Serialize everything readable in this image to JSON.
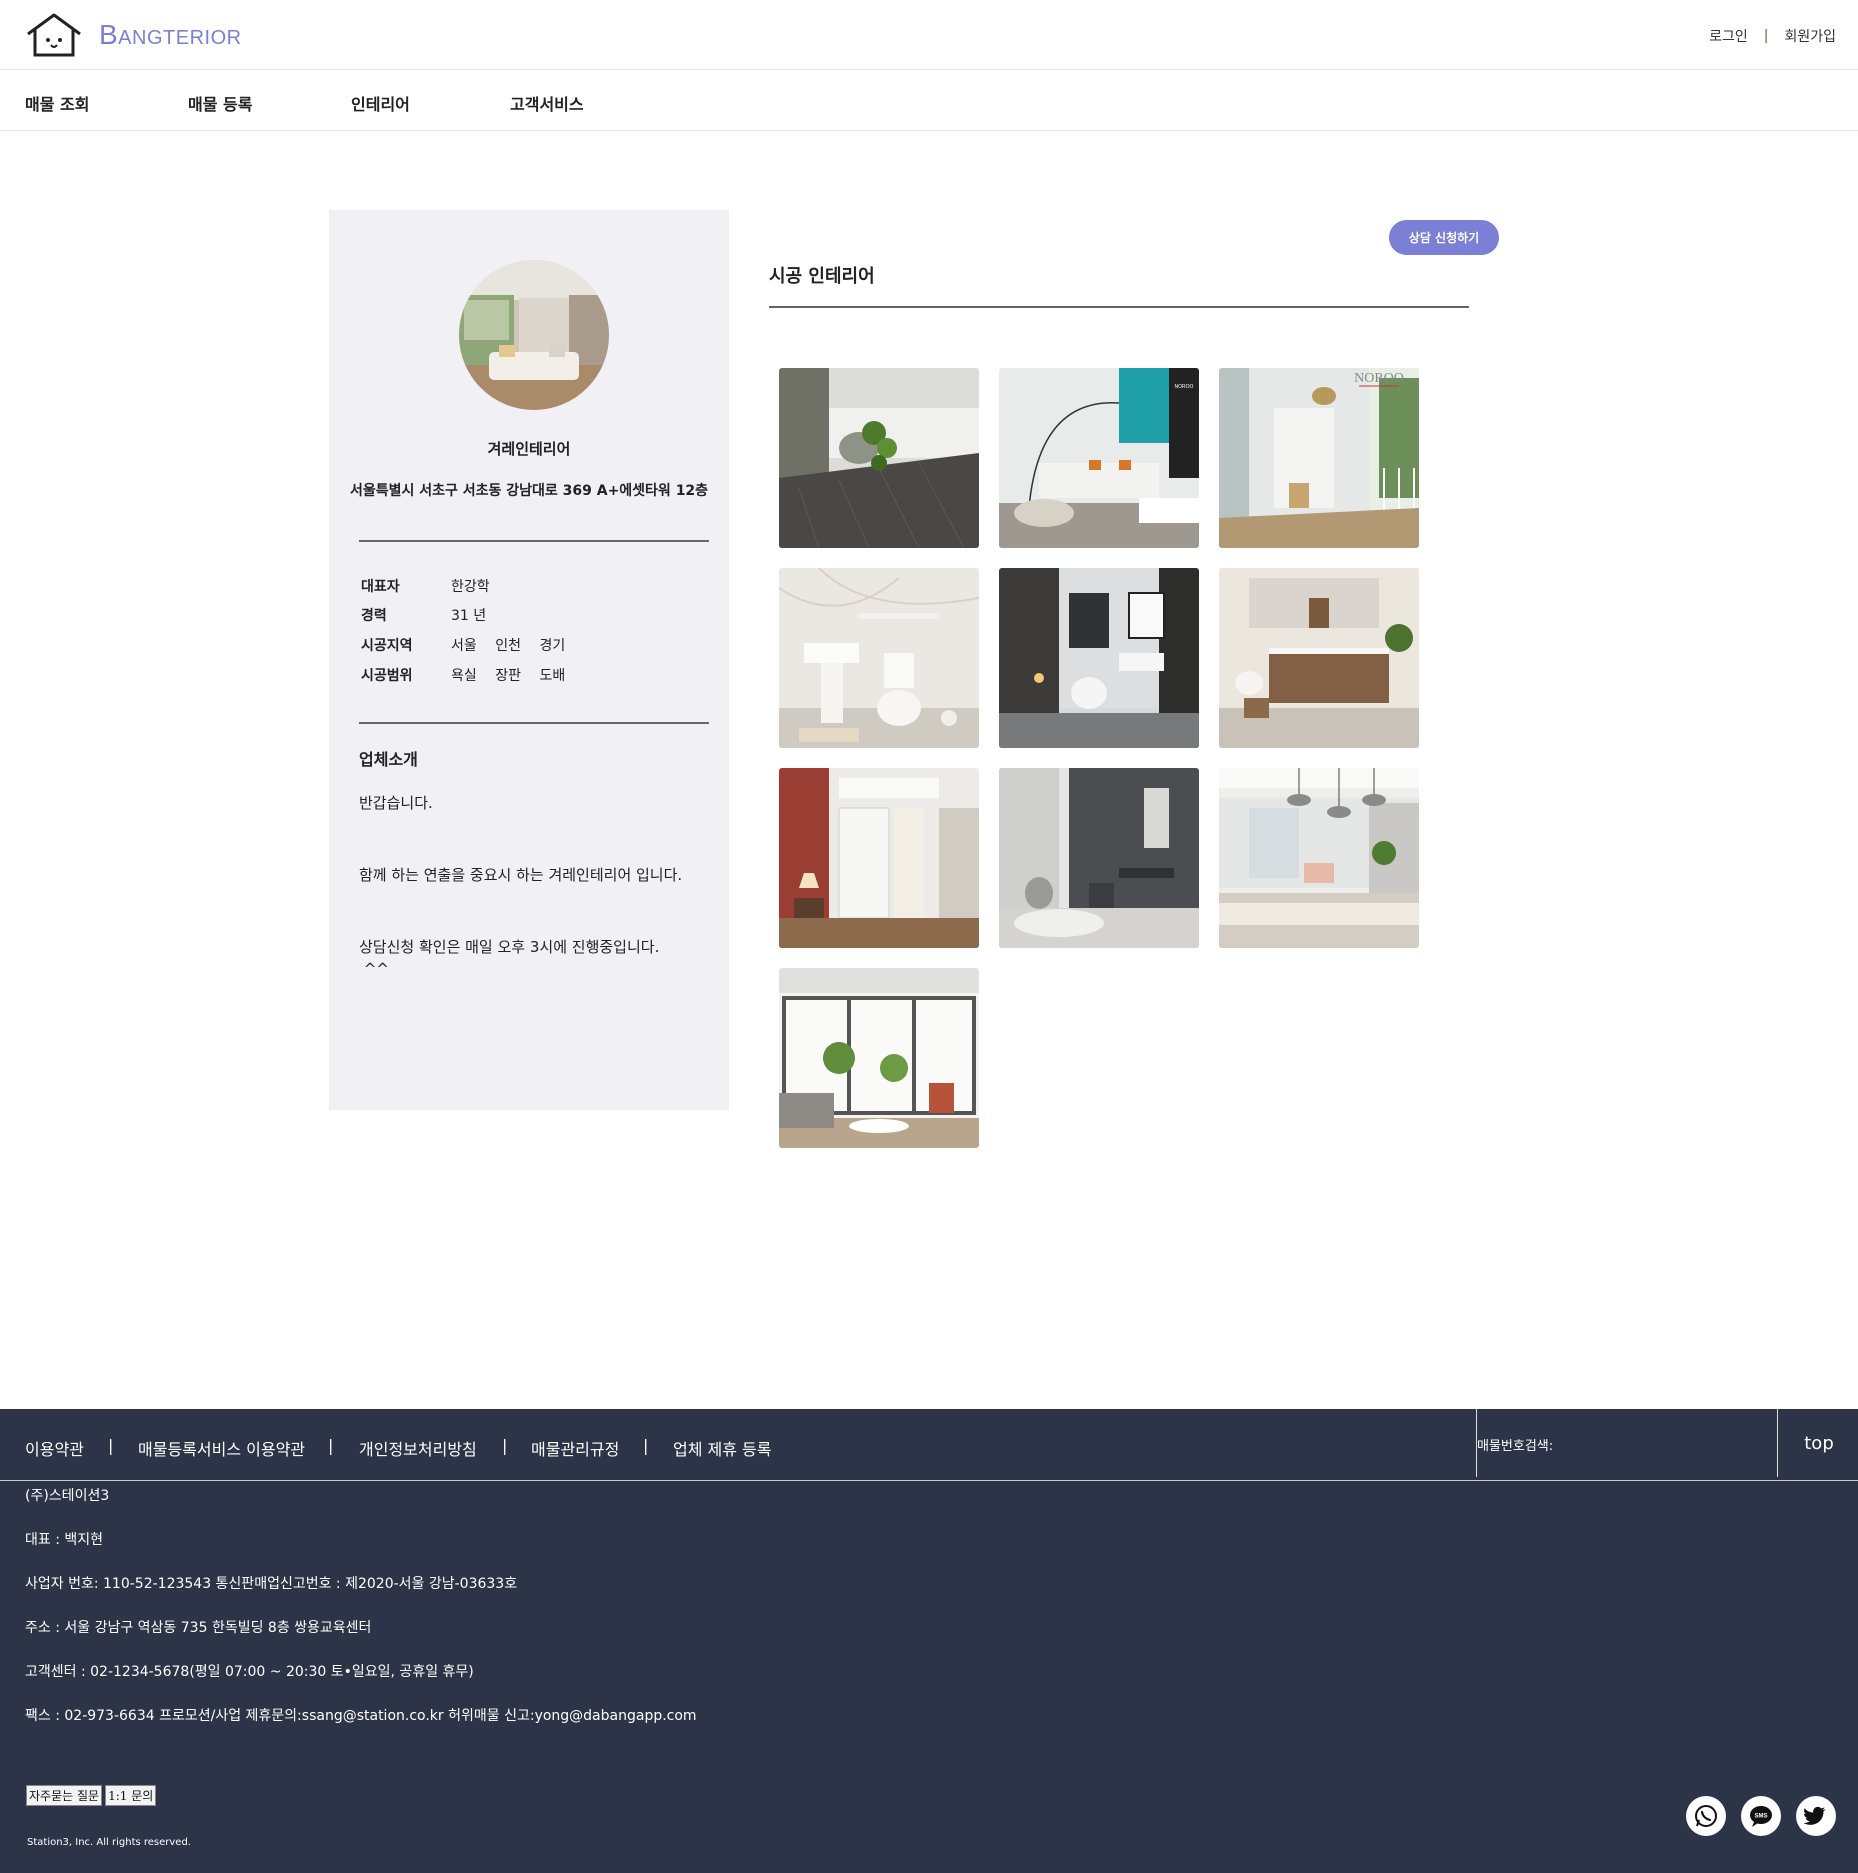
{
  "header": {
    "logo_text": "Bangterior",
    "login": "로그인",
    "separator": "|",
    "signup": "회원가입"
  },
  "nav": {
    "items": [
      "매물 조회",
      "매물 등록",
      "인테리어",
      "고객서비스"
    ]
  },
  "company": {
    "name": "겨레인테리어",
    "address": "서울특별시 서초구 서초동 강남대로 369 A+에셋타워 12층",
    "rows": [
      {
        "key": "대표자",
        "values": [
          "한강학"
        ]
      },
      {
        "key": "경력",
        "values": [
          "31 년"
        ]
      },
      {
        "key": "시공지역",
        "values": [
          "서울",
          "인천",
          "경기"
        ]
      },
      {
        "key": "시공범위",
        "values": [
          "욕실",
          "장판",
          "도배"
        ]
      }
    ],
    "intro_title": "업체소개",
    "intro_lines": [
      "반갑습니다.",
      "함께 하는 연출을 중요시 하는 겨레인테리어 입니다.",
      "상담신청 확인은 매일 오후 3시에 진행중입니다.",
      " ^^"
    ]
  },
  "main": {
    "consult_button": "상담 신청하기",
    "title": "시공 인테리어",
    "gallery": [
      {
        "name": "floor-plant"
      },
      {
        "name": "living-room-arc-lamp",
        "watermark": "NOROO"
      },
      {
        "name": "balcony-corridor",
        "watermark": "NOROO"
      },
      {
        "name": "white-bathroom"
      },
      {
        "name": "dark-bathroom"
      },
      {
        "name": "wood-vanity-bathroom"
      },
      {
        "name": "entrance-hallway"
      },
      {
        "name": "grey-dressing-room"
      },
      {
        "name": "dining-room-pendants"
      },
      {
        "name": "living-room-window"
      }
    ]
  },
  "footer": {
    "links": [
      "이용약관",
      "매물등록서비스 이용약관",
      "개인정보처리방침",
      "매물관리규정",
      "업체 제휴 등록"
    ],
    "separator": "|",
    "search_label": "매물번호검색:",
    "search_value": "",
    "top": "top",
    "info_lines": [
      "(주)스테이션3",
      "대표 : 백지현",
      "사업자 번호: 110-52-123543 통신판매업신고번호 : 제2020-서울 강남-03633호",
      "주소 : 서울 강남구 역삼동 735 한독빌딩 8층 쌍용교육센터",
      "고객센터 : 02-1234-5678(평일 07:00 ~ 20:30 토•일요일, 공휴일 휴무)",
      "팩스 : 02-973-6634  프로모션/사업 제휴문의:ssang@station.co.kr  허위매물 신고:yong@dabangapp.com"
    ],
    "faq_button": "자주묻는 질문",
    "inquiry_button": "1:1 문의",
    "copyright": "Station3, Inc. All rights reserved.",
    "social": [
      {
        "icon": "whatsapp-icon"
      },
      {
        "icon": "sms-icon",
        "label": "SMS"
      },
      {
        "icon": "twitter-icon"
      }
    ]
  }
}
